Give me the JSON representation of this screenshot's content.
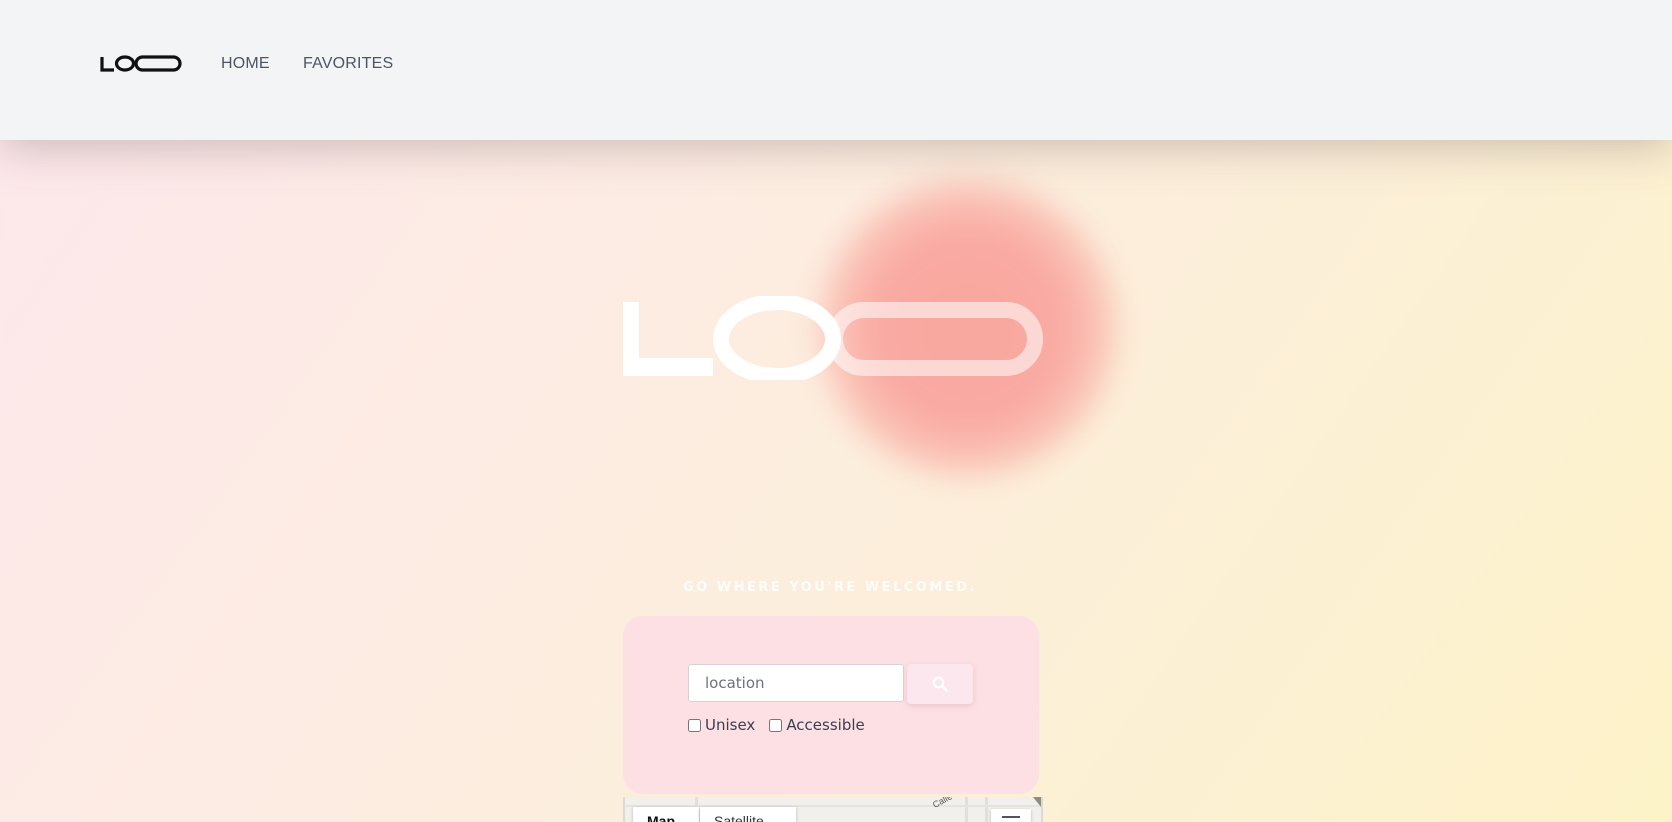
{
  "app": {
    "logo_text": "LOO"
  },
  "nav": {
    "home_label": "HOME",
    "favorites_label": "FAVORITES"
  },
  "hero": {
    "logo_text": "LOO",
    "tagline": "GO WHERE YOU'RE WELCOMED.",
    "blob_color": "#f9a79e"
  },
  "search": {
    "placeholder": "location",
    "value": "",
    "button_icon": "search-icon",
    "button_color": "#fce7ef",
    "card_color": "#fde0e4"
  },
  "filters": {
    "unisex_label": "Unisex",
    "unisex_checked": false,
    "accessible_label": "Accessible",
    "accessible_checked": false
  },
  "map": {
    "map_tab_label": "Map",
    "satellite_tab_label": "Satellite",
    "street_label": "Calle Ct",
    "fullscreen_icon": "fullscreen-icon"
  }
}
